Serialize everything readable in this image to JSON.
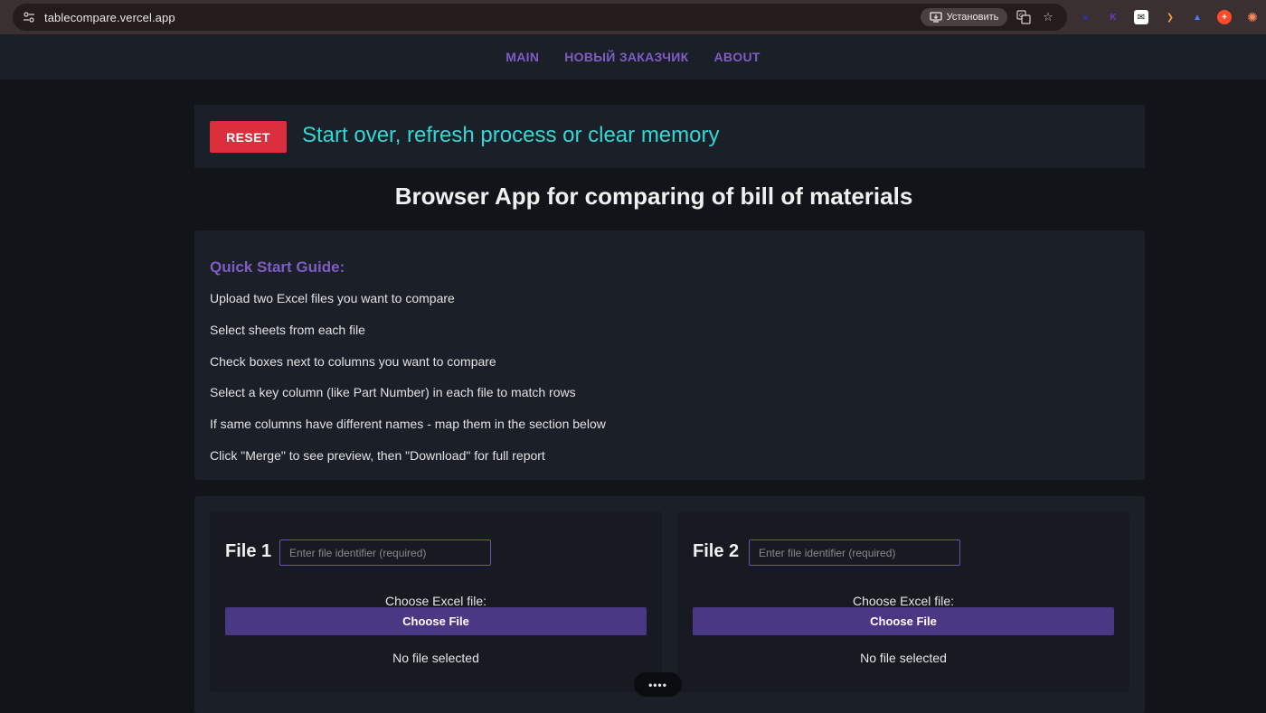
{
  "browser": {
    "url": "tablecompare.vercel.app",
    "install_label": "Установить",
    "extensions": [
      {
        "name": "extension-blue",
        "glyph": "●",
        "color": "#2a2fbf"
      },
      {
        "name": "extension-k",
        "glyph": "K",
        "color": "#6b3bc9"
      },
      {
        "name": "extension-shield",
        "glyph": "◆",
        "color": "#ffffff"
      },
      {
        "name": "extension-orange",
        "glyph": "❯",
        "color": "#f29a32"
      },
      {
        "name": "extension-blue-person",
        "glyph": "▲",
        "color": "#4f7dff"
      },
      {
        "name": "extension-red-plus",
        "glyph": "+",
        "color": "#ff4b2b"
      },
      {
        "name": "extension-sparkle",
        "glyph": "✺",
        "color": "#ff8a5c"
      }
    ]
  },
  "nav": {
    "items": [
      "MAIN",
      "НОВЫЙ ЗАКАЗЧИК",
      "ABOUT"
    ]
  },
  "reset": {
    "button_label": "RESET",
    "message": "Start over, refresh process or clear memory"
  },
  "title": "Browser App for comparing of bill of materials",
  "guide": {
    "title": "Quick Start Guide:",
    "steps": [
      "Upload two Excel files you want to compare",
      "Select sheets from each file",
      "Check boxes next to columns you want to compare",
      "Select a key column (like Part Number) in each file to match rows",
      "If same columns have different names - map them in the section below",
      "Click \"Merge\" to see preview, then \"Download\" for full report"
    ]
  },
  "files": [
    {
      "title": "File 1",
      "placeholder": "Enter file identifier (required)",
      "choose_label": "Choose Excel file:",
      "choose_button": "Choose File",
      "status": "No file selected"
    },
    {
      "title": "File 2",
      "placeholder": "Enter file identifier (required)",
      "choose_label": "Choose Excel file:",
      "choose_button": "Choose File",
      "status": "No file selected"
    }
  ],
  "floating": {
    "dots_label": "••••"
  },
  "colors": {
    "accent_purple": "#7f5cc6",
    "reset_red": "#dc2f3e",
    "message_cyan": "#33d6d6",
    "button_purple": "#4a3885"
  }
}
